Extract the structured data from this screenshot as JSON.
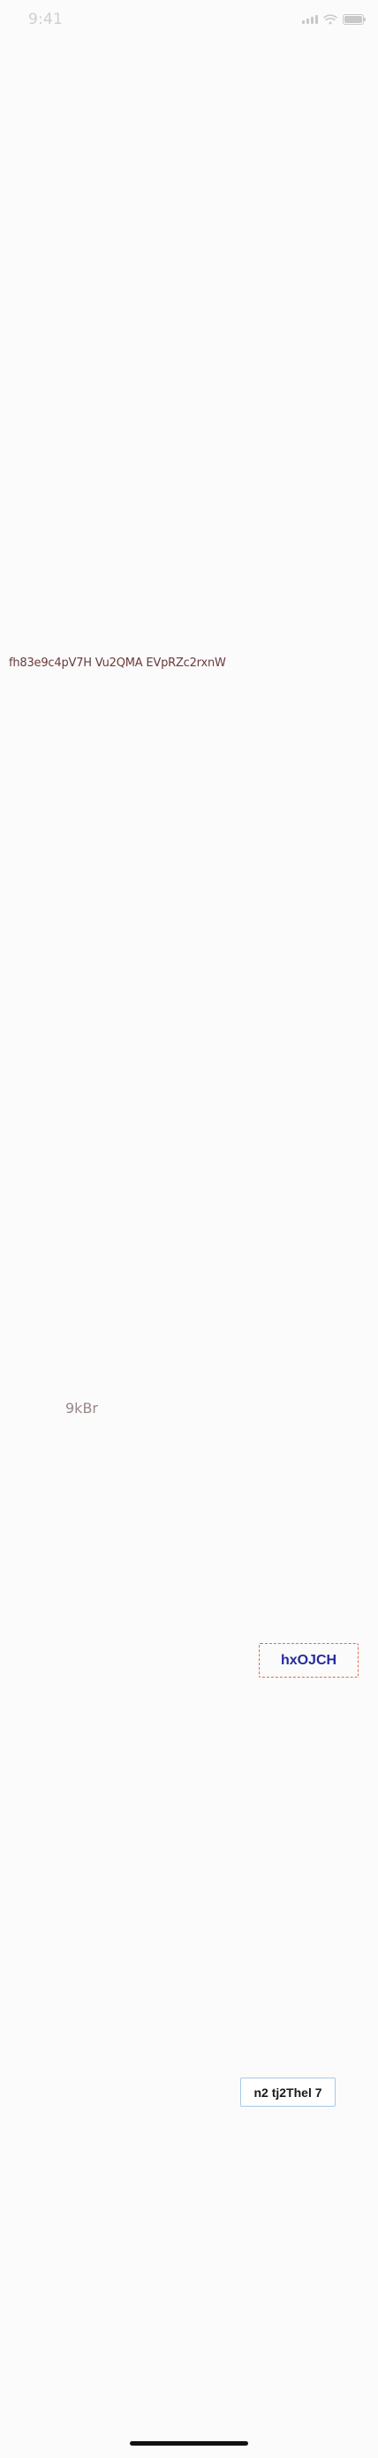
{
  "status_bar": {
    "time": "9:41",
    "icons": [
      "signal-icon",
      "wifi-icon",
      "battery-icon"
    ]
  },
  "content": {
    "text_line_1": "fh83e9c4pV7H Vu2QMA EVpRZc2rxnW",
    "text_9kbr": "9kBr",
    "button_hxojch": "hxOJCH",
    "button_n2": "n2 tj2Thel 7"
  },
  "colors": {
    "background": "#fbfbfb",
    "text_line_1": "#6a3a3a",
    "text_9kbr": "#9a8787",
    "button_hxojch_text": "#242a9c",
    "button_hxojch_border": "#e06d4f",
    "button_n2_text": "#1a1a1a",
    "button_n2_border": "#a6c9e8",
    "home_indicator": "#111111"
  }
}
